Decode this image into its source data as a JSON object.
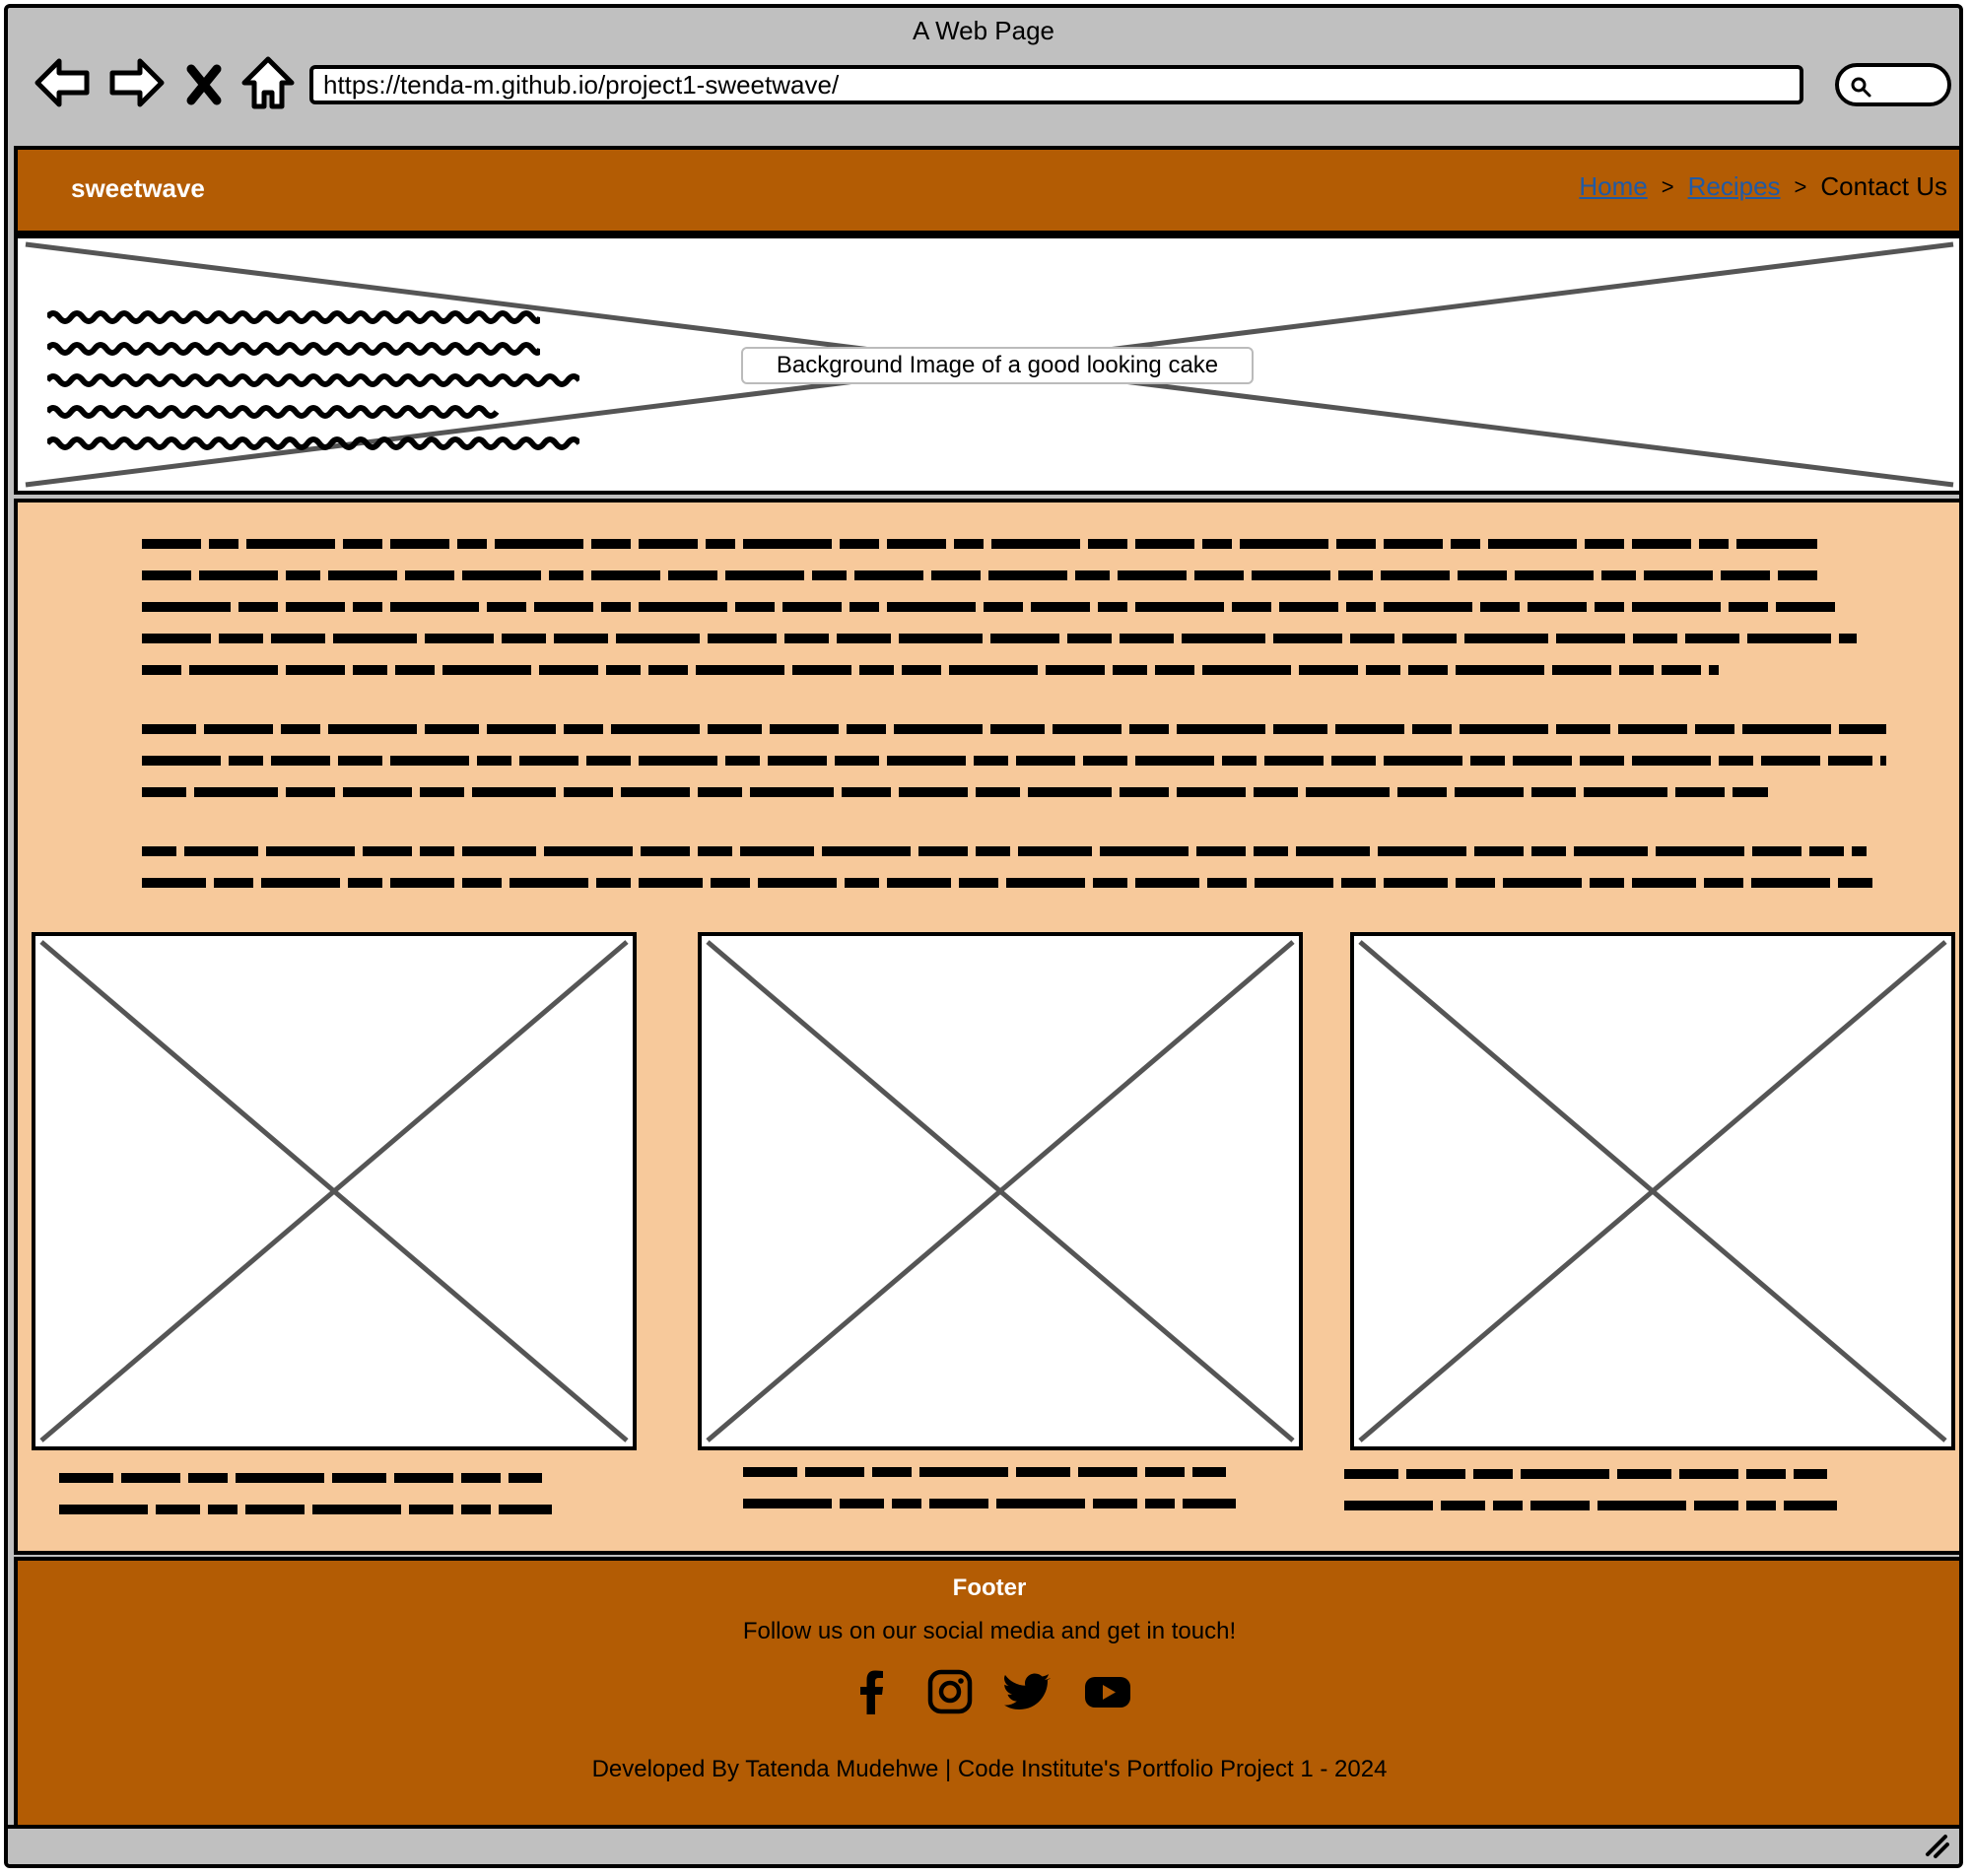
{
  "window": {
    "title": "A Web Page"
  },
  "browser": {
    "url": "https://tenda-m.github.io/project1-sweetwave/",
    "icons": [
      "back-arrow-icon",
      "forward-arrow-icon",
      "close-x-icon",
      "home-icon",
      "search-icon"
    ]
  },
  "header": {
    "brand": "sweetwave",
    "breadcrumb": [
      {
        "label": "Home",
        "link": true
      },
      {
        "label": "Recipes",
        "link": true
      },
      {
        "label": "Contact Us",
        "link": false
      }
    ],
    "separator": ">"
  },
  "hero": {
    "label": "Background Image of a good looking cake"
  },
  "footer": {
    "title": "Footer",
    "subtitle": "Follow us on our social media and get in touch!",
    "social_icons": [
      "facebook-icon",
      "instagram-icon",
      "twitter-icon",
      "youtube-icon"
    ],
    "credit": "Developed By Tatenda Mudehwe | Code Institute's Portfolio Project 1 - 2024"
  },
  "colors": {
    "header_bg": "#b35c04",
    "main_bg": "#f7c99b",
    "chrome_bg": "#c0c0c0",
    "link": "#1f5aa6"
  }
}
